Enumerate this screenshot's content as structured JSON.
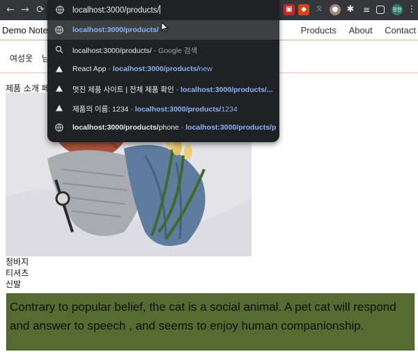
{
  "browser": {
    "address_text": "localhost:3000/products/",
    "address_typed": "localhost",
    "address_rest": ":3000/products/",
    "suggestions": [
      {
        "icon": "globe-icon",
        "parts": [
          {
            "t": "localhost:3000/products/",
            "c": "url b"
          }
        ]
      },
      {
        "icon": "search-icon",
        "parts": [
          {
            "t": "localhost:3000/products/",
            "c": ""
          },
          {
            "t": " - Google 검색",
            "c": "gray"
          }
        ]
      },
      {
        "icon": "react-icon",
        "parts": [
          {
            "t": "React App",
            "c": ""
          },
          {
            "t": " - ",
            "c": "sep"
          },
          {
            "t": "localhost:3000/products/",
            "c": "url b"
          },
          {
            "t": "new",
            "c": "url"
          }
        ]
      },
      {
        "icon": "react-icon",
        "parts": [
          {
            "t": "멋진 제품 사이트 | 전체 제품 확인",
            "c": ""
          },
          {
            "t": " - ",
            "c": "sep"
          },
          {
            "t": "localhost:3000/products/...",
            "c": "url b"
          }
        ]
      },
      {
        "icon": "react-icon",
        "parts": [
          {
            "t": "제품의 이름: 1234",
            "c": ""
          },
          {
            "t": " - ",
            "c": "sep"
          },
          {
            "t": "localhost:3000/products/",
            "c": "url b"
          },
          {
            "t": "1234",
            "c": "url"
          }
        ]
      },
      {
        "icon": "globe-icon",
        "parts": [
          {
            "t": "localhost:3000/products/",
            "c": "b"
          },
          {
            "t": "phone",
            "c": ""
          },
          {
            "t": " - ",
            "c": "sep"
          },
          {
            "t": "localhost:3000/products/p...",
            "c": "url b"
          }
        ]
      }
    ]
  },
  "site": {
    "brand": "Demo Note",
    "nav": [
      "Products",
      "About",
      "Contact"
    ],
    "categories": [
      "여성옷",
      "남"
    ],
    "intro": "제품 소개 페",
    "items": [
      "청바지",
      "티셔츠",
      "신발"
    ],
    "quote": "Contrary to popular belief, the cat is a social animal. A pet cat will respond and answer to speech , and seems to enjoy human companionship."
  },
  "colors": {
    "chrome_bar": "#35363a",
    "omnibox_bg": "#202124",
    "url_blue": "#8ab4f8",
    "quote_bg": "#556b2f",
    "header_border": "#d9a99a"
  }
}
